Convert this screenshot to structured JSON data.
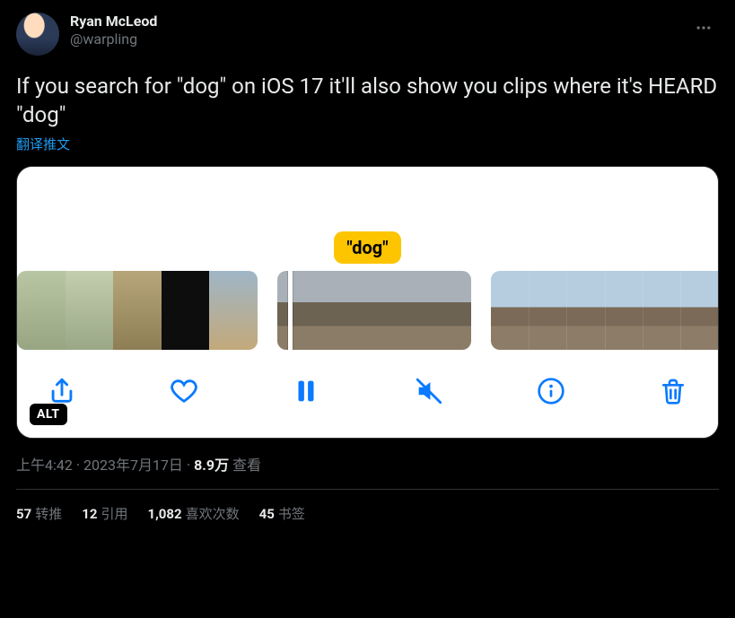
{
  "author": {
    "display_name": "Ryan McLeod",
    "handle": "@warpling"
  },
  "tweet_text": "If you search for \"dog\" on iOS 17 it'll also show you clips where it's HEARD \"dog\"",
  "translate_label": "翻译推文",
  "media": {
    "caption_bubble": "\"dog\"",
    "alt_badge": "ALT",
    "toolbar_icons": {
      "share": "share-icon",
      "like": "heart-icon",
      "pause": "pause-icon",
      "mute": "speaker-slash-icon",
      "info": "info-icon",
      "trash": "trash-icon"
    }
  },
  "meta": {
    "time": "上午4:42",
    "dot1": " · ",
    "date": "2023年7月17日",
    "dot2": " · ",
    "views_count": "8.9万",
    "views_label": " 查看"
  },
  "stats": {
    "retweets": {
      "count": "57",
      "label": "转推"
    },
    "quotes": {
      "count": "12",
      "label": "引用"
    },
    "likes": {
      "count": "1,082",
      "label": "喜欢次数"
    },
    "bookmarks": {
      "count": "45",
      "label": "书签"
    }
  }
}
